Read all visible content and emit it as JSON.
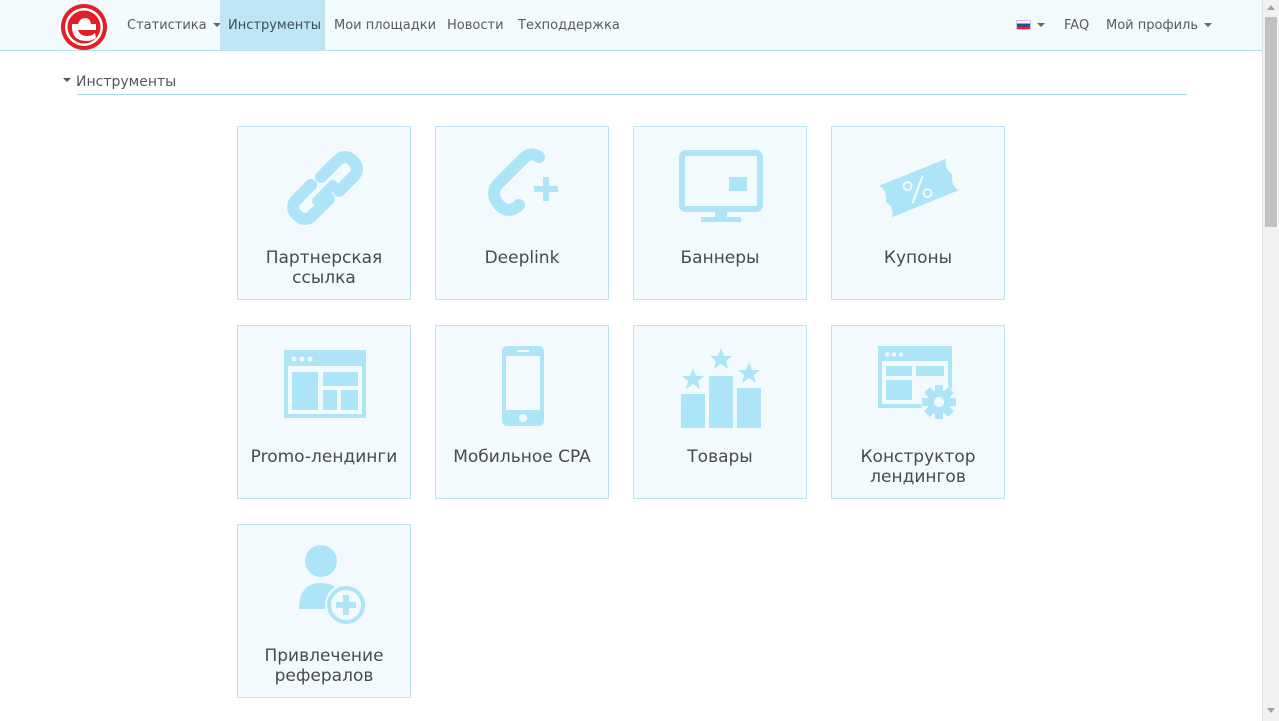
{
  "nav": {
    "items": [
      {
        "label": "Статистика",
        "dropdown": true
      },
      {
        "label": "Инструменты",
        "active": true
      },
      {
        "label": "Мои площадки"
      },
      {
        "label": "Новости"
      },
      {
        "label": "Техподдержка"
      }
    ],
    "right": {
      "language": "ru-flag",
      "faq": "FAQ",
      "profile": "Мой профиль"
    }
  },
  "section": {
    "title": "Инструменты"
  },
  "colors": {
    "accent": "#aee4f7",
    "logo": "#e01f26",
    "tile_bg": "#f2fafd",
    "tile_border": "#bfe5f3"
  },
  "tiles": [
    {
      "line1": "Партнерская",
      "line2": "ссылка",
      "icon": "chain-link-icon"
    },
    {
      "line1": "Deeplink",
      "line2": "",
      "icon": "deeplink-icon"
    },
    {
      "line1": "Баннеры",
      "line2": "",
      "icon": "monitor-icon"
    },
    {
      "line1": "Купоны",
      "line2": "",
      "icon": "coupon-icon"
    },
    {
      "line1": "Promo-лендинги",
      "line2": "",
      "icon": "landing-page-icon"
    },
    {
      "line1": "Мобильное CPA",
      "line2": "",
      "icon": "smartphone-icon"
    },
    {
      "line1": "Товары",
      "line2": "",
      "icon": "products-stars-icon"
    },
    {
      "line1": "Конструктор",
      "line2": "лендингов",
      "icon": "landing-builder-icon"
    },
    {
      "line1": "Привлечение",
      "line2": "рефералов",
      "icon": "add-user-icon"
    }
  ]
}
